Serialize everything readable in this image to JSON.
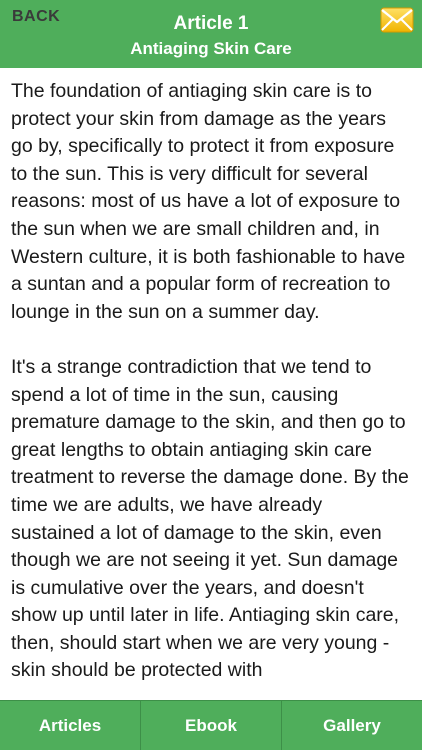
{
  "header": {
    "back_label": "BACK",
    "title": "Article 1",
    "subtitle": "Antiaging Skin Care",
    "mail_icon": "envelope-icon"
  },
  "article": {
    "paragraphs": [
      "The foundation of antiaging skin care is to protect your skin from damage as the years go by, specifically to protect it from exposure to the sun. This is very difficult for several reasons: most of us have a lot of exposure to the sun when we are small children and, in Western culture, it is both fashionable to have a suntan and a popular form of recreation to lounge in the sun on a summer day.",
      "It's a strange contradiction that we tend to spend a lot of time in the sun, causing premature damage to the skin, and then go to great lengths to obtain antiaging skin care treatment to reverse the damage done. By the time we are adults, we have already sustained a lot of damage to the skin, even though we are not seeing it yet. Sun damage is cumulative over the years, and doesn't show up until later in life. Antiaging skin care, then, should start when we are very young - skin should be protected with"
    ]
  },
  "tabs": [
    {
      "label": "Articles"
    },
    {
      "label": "Ebook"
    },
    {
      "label": "Gallery"
    }
  ],
  "colors": {
    "bar_green": "#4fae5b",
    "envelope_yellow": "#f5c518"
  }
}
